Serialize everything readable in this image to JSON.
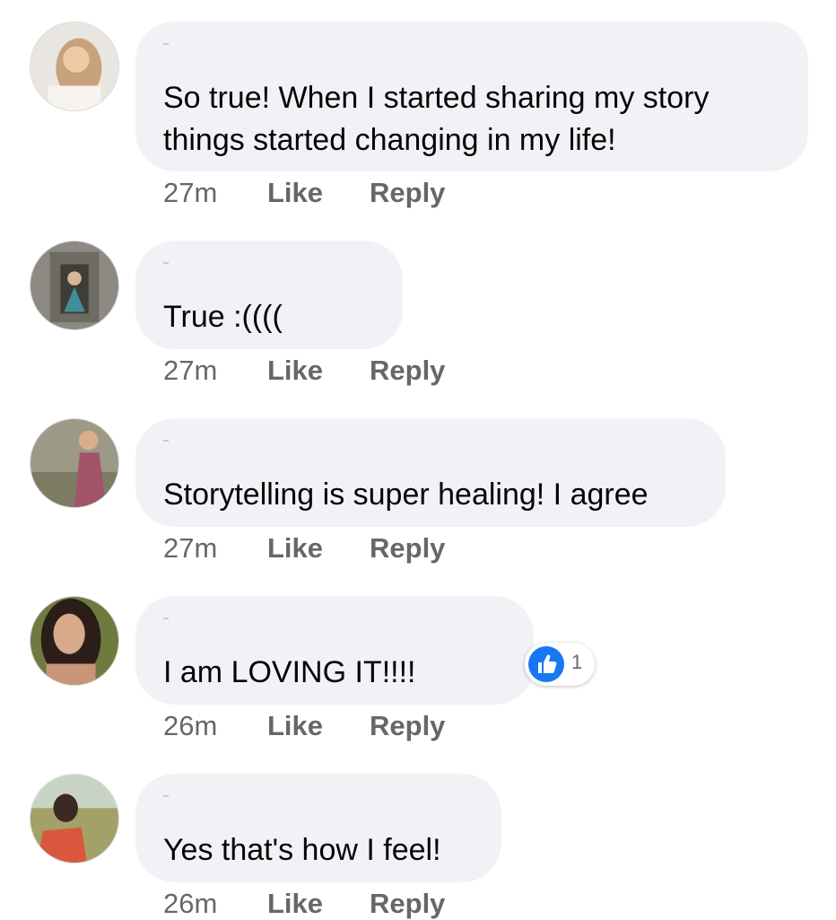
{
  "colors": {
    "bubble_bg": "#f0f2f5",
    "text": "#050505",
    "meta": "#65676b",
    "like_blue": "#1877f2"
  },
  "comments": [
    {
      "avatar_icon": "avatar-photo",
      "text": "So true! When I started sharing my story\nthings started changing in my life!",
      "time": "27m",
      "like": "Like",
      "reply": "Reply"
    },
    {
      "avatar_icon": "avatar-photo",
      "text": "True :((((",
      "time": "27m",
      "like": "Like",
      "reply": "Reply"
    },
    {
      "avatar_icon": "avatar-photo",
      "text": "Storytelling is super healing! I agree",
      "time": "27m",
      "like": "Like",
      "reply": "Reply"
    },
    {
      "avatar_icon": "avatar-photo",
      "text": "I am LOVING IT!!!!",
      "time": "26m",
      "like": "Like",
      "reply": "Reply",
      "reaction": {
        "icon": "thumbs-up-icon",
        "count": "1"
      }
    },
    {
      "avatar_icon": "avatar-photo",
      "text": "Yes that's how I feel!",
      "time": "26m",
      "like": "Like",
      "reply": "Reply"
    }
  ]
}
